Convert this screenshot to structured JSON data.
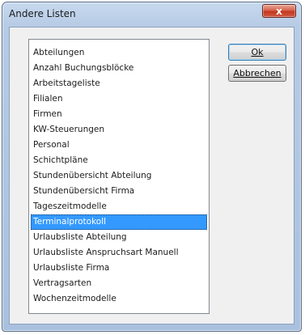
{
  "window": {
    "title": "Andere Listen",
    "close_label": "x"
  },
  "list": {
    "items": [
      "Abteilungen",
      "Anzahl Buchungsblöcke",
      "Arbeitstageliste",
      "Filialen",
      "Firmen",
      "KW-Steuerungen",
      "Personal",
      "Schichtpläne",
      "Stundenübersicht Abteilung",
      "Stundenübersicht Firma",
      "Tageszeitmodelle",
      "Terminalprotokoll",
      "Urlaubsliste Abteilung",
      "Urlaubsliste Anspruchsart Manuell",
      "Urlaubsliste Firma",
      "Vertragsarten",
      "Wochenzeitmodelle"
    ],
    "selected_index": 11
  },
  "buttons": {
    "ok_label": "Ok",
    "cancel_label": "Abbrechen"
  },
  "colors": {
    "selection": "#3399ff",
    "close_button": "#c3381f"
  }
}
